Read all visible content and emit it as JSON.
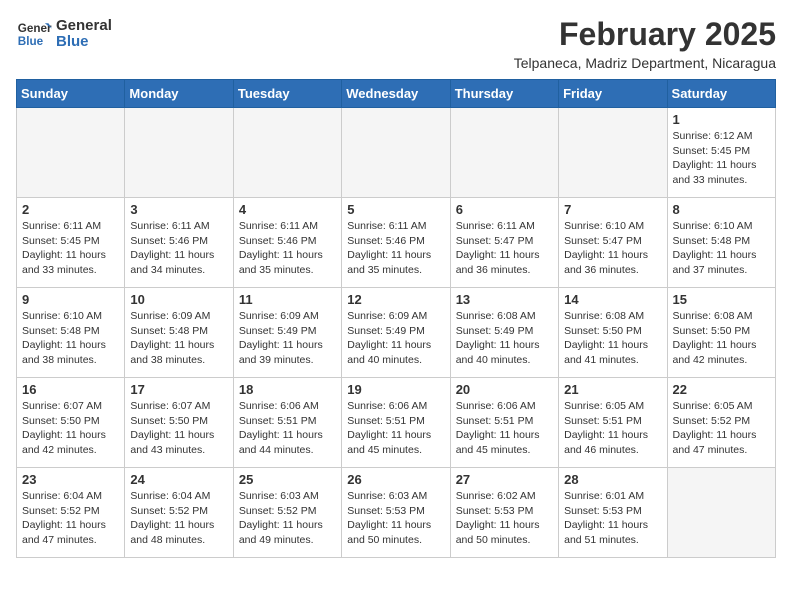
{
  "header": {
    "logo_line1": "General",
    "logo_line2": "Blue",
    "month_year": "February 2025",
    "location": "Telpaneca, Madriz Department, Nicaragua"
  },
  "weekdays": [
    "Sunday",
    "Monday",
    "Tuesday",
    "Wednesday",
    "Thursday",
    "Friday",
    "Saturday"
  ],
  "weeks": [
    [
      {
        "day": "",
        "info": ""
      },
      {
        "day": "",
        "info": ""
      },
      {
        "day": "",
        "info": ""
      },
      {
        "day": "",
        "info": ""
      },
      {
        "day": "",
        "info": ""
      },
      {
        "day": "",
        "info": ""
      },
      {
        "day": "1",
        "info": "Sunrise: 6:12 AM\nSunset: 5:45 PM\nDaylight: 11 hours\nand 33 minutes."
      }
    ],
    [
      {
        "day": "2",
        "info": "Sunrise: 6:11 AM\nSunset: 5:45 PM\nDaylight: 11 hours\nand 33 minutes."
      },
      {
        "day": "3",
        "info": "Sunrise: 6:11 AM\nSunset: 5:46 PM\nDaylight: 11 hours\nand 34 minutes."
      },
      {
        "day": "4",
        "info": "Sunrise: 6:11 AM\nSunset: 5:46 PM\nDaylight: 11 hours\nand 35 minutes."
      },
      {
        "day": "5",
        "info": "Sunrise: 6:11 AM\nSunset: 5:46 PM\nDaylight: 11 hours\nand 35 minutes."
      },
      {
        "day": "6",
        "info": "Sunrise: 6:11 AM\nSunset: 5:47 PM\nDaylight: 11 hours\nand 36 minutes."
      },
      {
        "day": "7",
        "info": "Sunrise: 6:10 AM\nSunset: 5:47 PM\nDaylight: 11 hours\nand 36 minutes."
      },
      {
        "day": "8",
        "info": "Sunrise: 6:10 AM\nSunset: 5:48 PM\nDaylight: 11 hours\nand 37 minutes."
      }
    ],
    [
      {
        "day": "9",
        "info": "Sunrise: 6:10 AM\nSunset: 5:48 PM\nDaylight: 11 hours\nand 38 minutes."
      },
      {
        "day": "10",
        "info": "Sunrise: 6:09 AM\nSunset: 5:48 PM\nDaylight: 11 hours\nand 38 minutes."
      },
      {
        "day": "11",
        "info": "Sunrise: 6:09 AM\nSunset: 5:49 PM\nDaylight: 11 hours\nand 39 minutes."
      },
      {
        "day": "12",
        "info": "Sunrise: 6:09 AM\nSunset: 5:49 PM\nDaylight: 11 hours\nand 40 minutes."
      },
      {
        "day": "13",
        "info": "Sunrise: 6:08 AM\nSunset: 5:49 PM\nDaylight: 11 hours\nand 40 minutes."
      },
      {
        "day": "14",
        "info": "Sunrise: 6:08 AM\nSunset: 5:50 PM\nDaylight: 11 hours\nand 41 minutes."
      },
      {
        "day": "15",
        "info": "Sunrise: 6:08 AM\nSunset: 5:50 PM\nDaylight: 11 hours\nand 42 minutes."
      }
    ],
    [
      {
        "day": "16",
        "info": "Sunrise: 6:07 AM\nSunset: 5:50 PM\nDaylight: 11 hours\nand 42 minutes."
      },
      {
        "day": "17",
        "info": "Sunrise: 6:07 AM\nSunset: 5:50 PM\nDaylight: 11 hours\nand 43 minutes."
      },
      {
        "day": "18",
        "info": "Sunrise: 6:06 AM\nSunset: 5:51 PM\nDaylight: 11 hours\nand 44 minutes."
      },
      {
        "day": "19",
        "info": "Sunrise: 6:06 AM\nSunset: 5:51 PM\nDaylight: 11 hours\nand 45 minutes."
      },
      {
        "day": "20",
        "info": "Sunrise: 6:06 AM\nSunset: 5:51 PM\nDaylight: 11 hours\nand 45 minutes."
      },
      {
        "day": "21",
        "info": "Sunrise: 6:05 AM\nSunset: 5:51 PM\nDaylight: 11 hours\nand 46 minutes."
      },
      {
        "day": "22",
        "info": "Sunrise: 6:05 AM\nSunset: 5:52 PM\nDaylight: 11 hours\nand 47 minutes."
      }
    ],
    [
      {
        "day": "23",
        "info": "Sunrise: 6:04 AM\nSunset: 5:52 PM\nDaylight: 11 hours\nand 47 minutes."
      },
      {
        "day": "24",
        "info": "Sunrise: 6:04 AM\nSunset: 5:52 PM\nDaylight: 11 hours\nand 48 minutes."
      },
      {
        "day": "25",
        "info": "Sunrise: 6:03 AM\nSunset: 5:52 PM\nDaylight: 11 hours\nand 49 minutes."
      },
      {
        "day": "26",
        "info": "Sunrise: 6:03 AM\nSunset: 5:53 PM\nDaylight: 11 hours\nand 50 minutes."
      },
      {
        "day": "27",
        "info": "Sunrise: 6:02 AM\nSunset: 5:53 PM\nDaylight: 11 hours\nand 50 minutes."
      },
      {
        "day": "28",
        "info": "Sunrise: 6:01 AM\nSunset: 5:53 PM\nDaylight: 11 hours\nand 51 minutes."
      },
      {
        "day": "",
        "info": ""
      }
    ]
  ]
}
